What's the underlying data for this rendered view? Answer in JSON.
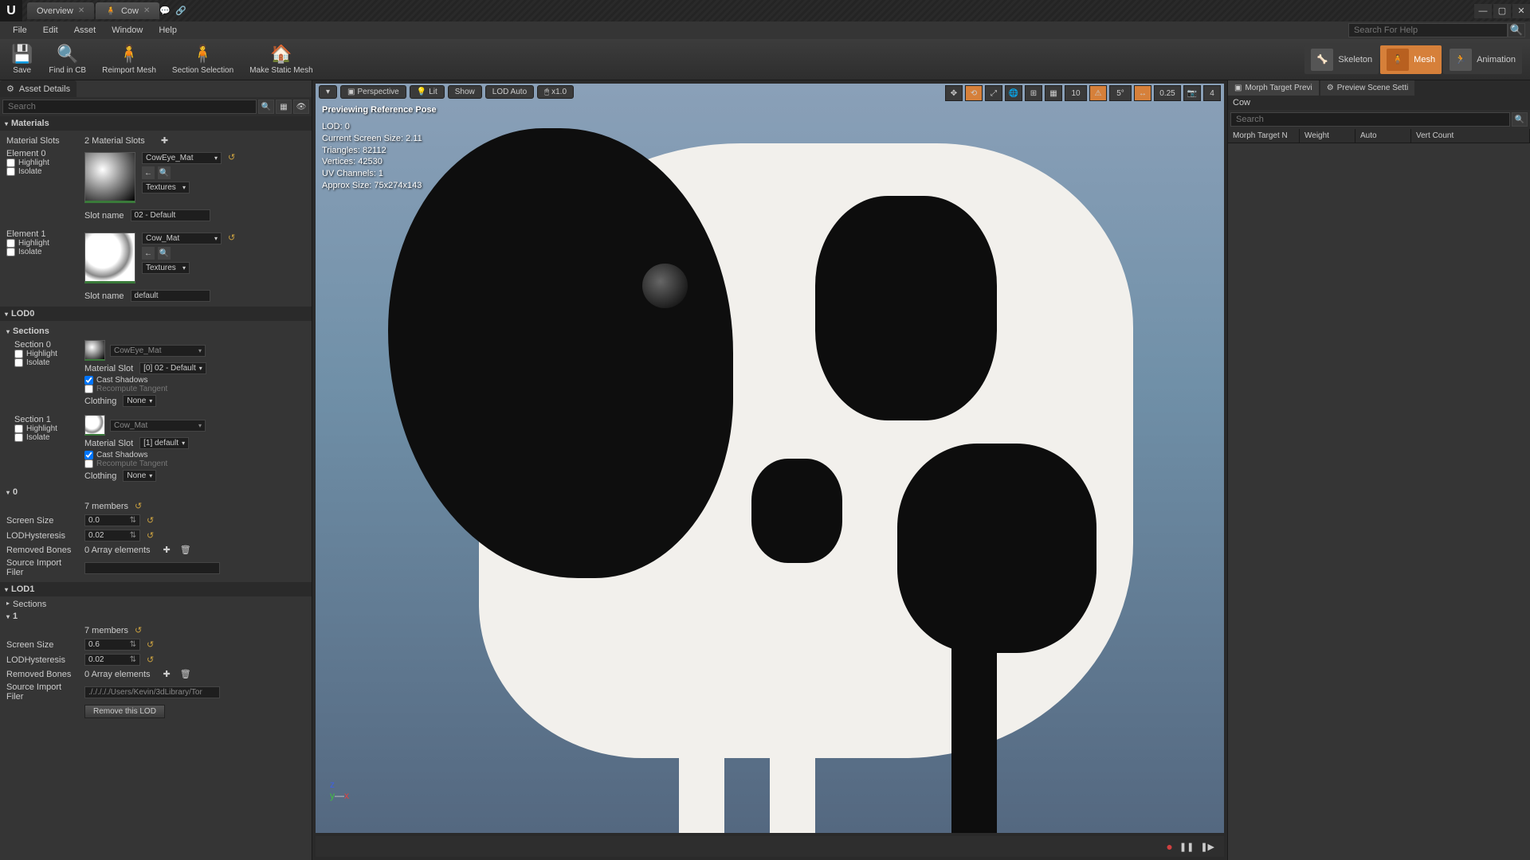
{
  "titlebar": {
    "tabs": [
      {
        "label": "Overview"
      },
      {
        "label": "Cow"
      }
    ]
  },
  "menus": [
    "File",
    "Edit",
    "Asset",
    "Window",
    "Help"
  ],
  "help_search_placeholder": "Search For Help",
  "toolbar": [
    {
      "label": "Save",
      "icon": "💾"
    },
    {
      "label": "Find in CB",
      "icon": "🔍"
    },
    {
      "label": "Reimport Mesh",
      "icon": "🧍"
    },
    {
      "label": "Section Selection",
      "icon": "🧍"
    },
    {
      "label": "Make Static Mesh",
      "icon": "🏠"
    }
  ],
  "modes": [
    {
      "label": "Skeleton"
    },
    {
      "label": "Mesh"
    },
    {
      "label": "Animation"
    }
  ],
  "left": {
    "panel_title": "Asset Details",
    "search_placeholder": "Search",
    "materials": {
      "header": "Materials",
      "slots_label": "Material Slots",
      "slots_count": "2 Material Slots",
      "elements": [
        {
          "el": "Element 0",
          "mat": "CowEye_Mat",
          "tex": "Textures",
          "slot": "Slot name",
          "slot_val": "02 - Default",
          "hl": "Highlight",
          "iso": "Isolate"
        },
        {
          "el": "Element 1",
          "mat": "Cow_Mat",
          "tex": "Textures",
          "slot": "Slot name",
          "slot_val": "default",
          "hl": "Highlight",
          "iso": "Isolate"
        }
      ]
    },
    "lod0": {
      "header": "LOD0",
      "sections_label": "Sections",
      "sections": [
        {
          "sec": "Section 0",
          "mat": "CowEye_Mat",
          "mslot": "Material Slot",
          "mslot_val": "[0] 02 - Default",
          "cast": "Cast Shadows",
          "recomp": "Recompute Tangent",
          "cloth": "Clothing",
          "cloth_val": "None",
          "hl": "Highlight",
          "iso": "Isolate"
        },
        {
          "sec": "Section 1",
          "mat": "Cow_Mat",
          "mslot": "Material Slot",
          "mslot_val": "[1] default",
          "cast": "Cast Shadows",
          "recomp": "Recompute Tangent",
          "cloth": "Clothing",
          "cloth_val": "None",
          "hl": "Highlight",
          "iso": "Isolate"
        }
      ],
      "group0": "0",
      "members": "7 members",
      "screen_size": "Screen Size",
      "screen_size_val": "0.0",
      "hyst": "LODHysteresis",
      "hyst_val": "0.02",
      "removed": "Removed Bones",
      "removed_val": "0 Array elements",
      "src": "Source Import Filer",
      "src_val": ""
    },
    "lod1": {
      "header": "LOD1",
      "sections_label": "Sections",
      "group1": "1",
      "members": "7 members",
      "screen_size": "Screen Size",
      "screen_size_val": "0.6",
      "hyst": "LODHysteresis",
      "hyst_val": "0.02",
      "removed": "Removed Bones",
      "removed_val": "0 Array elements",
      "src": "Source Import Filer",
      "src_val": "./././././Users/Kevin/3dLibrary/Tor",
      "remove_btn": "Remove this LOD"
    }
  },
  "viewport": {
    "buttons": {
      "persp": "Perspective",
      "lit": "Lit",
      "show": "Show",
      "lod": "LOD Auto",
      "speed": "x1.0"
    },
    "preview": "Previewing Reference Pose",
    "stats": [
      "LOD: 0",
      "Current Screen Size: 2.11",
      "Triangles: 82112",
      "Vertices: 42530",
      "UV Channels: 1",
      "Approx Size: 75x274x143"
    ],
    "grid": "10",
    "angle": "5°",
    "scale": "0.25",
    "cam": "4"
  },
  "right": {
    "tabs": [
      "Morph Target Previ",
      "Preview Scene Setti"
    ],
    "asset": "Cow",
    "search_placeholder": "Search",
    "cols": [
      "Morph Target N",
      "Weight",
      "Auto",
      "Vert Count"
    ]
  }
}
